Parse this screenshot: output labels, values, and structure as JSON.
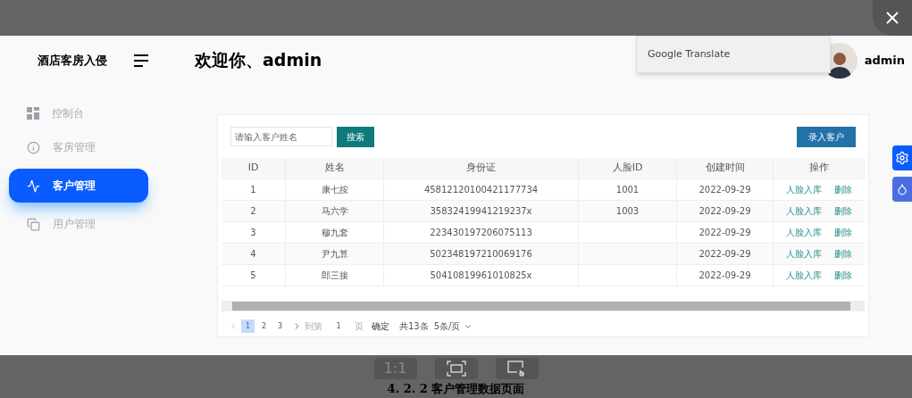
{
  "viewer": {
    "toolbar": [
      {
        "kind": "text",
        "label": "1:1"
      },
      {
        "kind": "fit"
      },
      {
        "kind": "crop"
      }
    ],
    "caption": "4. 2. 2 客户管理数据页面"
  },
  "app": {
    "brand": "酒店客房入侵",
    "welcome": "欢迎你、admin",
    "translate_popup": "Google Translate",
    "user": "admin",
    "sidebar": [
      {
        "label": "控制台",
        "selected": false
      },
      {
        "label": "客房管理",
        "selected": false
      },
      {
        "label": "客户管理",
        "selected": true
      },
      {
        "label": "用户管理",
        "selected": false
      }
    ],
    "search": {
      "placeholder": "请输入客户姓名",
      "button": "搜索"
    },
    "add_button": "录入客户",
    "table": {
      "columns": [
        "ID",
        "姓名",
        "身份证",
        "人脸ID",
        "创建时间",
        "操作"
      ],
      "rows": [
        {
          "id": "1",
          "name": "康七按",
          "id_card": "45812120100421177734",
          "face_id": "1001",
          "created": "2022-09-29",
          "actions": [
            "人脸入库",
            "删除"
          ]
        },
        {
          "id": "2",
          "name": "马六学",
          "id_card": "35832419941219237x",
          "face_id": "1003",
          "created": "2022-09-29",
          "actions": [
            "人脸入库",
            "删除"
          ]
        },
        {
          "id": "3",
          "name": "穆九套",
          "id_card": "223430197206075113",
          "created": "2022-09-29",
          "actions": [
            "人脸入库",
            "删除"
          ]
        },
        {
          "id": "4",
          "name": "尹九算",
          "id_card": "502348197210069176",
          "created": "2022-09-29",
          "actions": [
            "人脸入库",
            "删除"
          ]
        },
        {
          "id": "5",
          "name": "郎三接",
          "id_card": "50410819961010825x",
          "created": "2022-09-29",
          "actions": [
            "人脸入库",
            "删除"
          ]
        }
      ]
    },
    "pagination": {
      "pages": [
        {
          "label": "1",
          "selected": true
        },
        {
          "label": "2",
          "selected": false
        },
        {
          "label": "3",
          "selected": false
        }
      ],
      "goto_label": "到第",
      "goto_value": "1",
      "page_unit": "页",
      "confirm": "确定",
      "total": "共13条",
      "page_size": "5条/页"
    }
  }
}
